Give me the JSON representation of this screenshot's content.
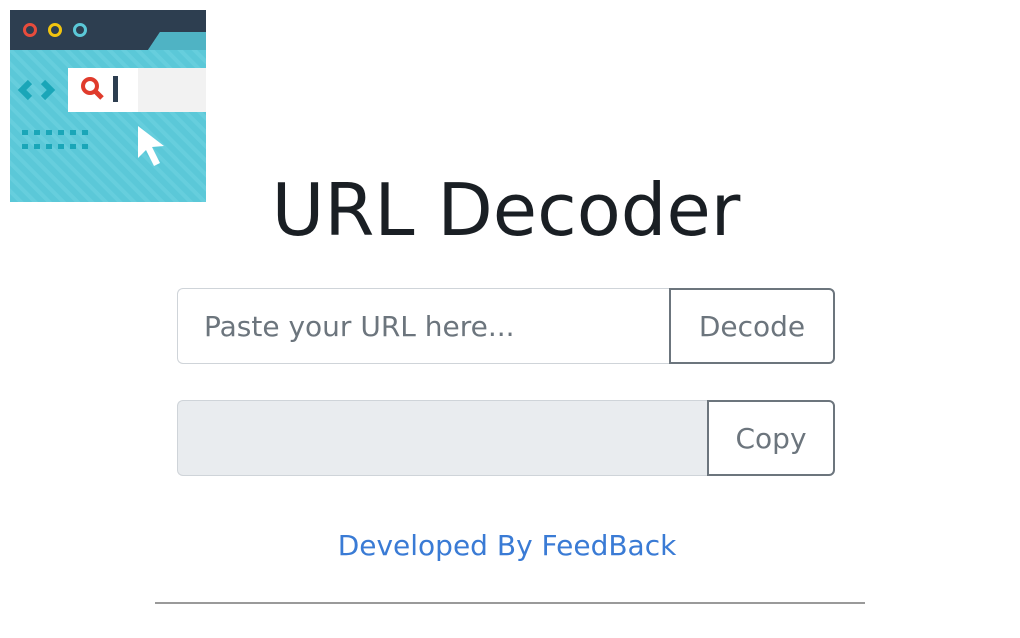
{
  "app": {
    "title": "URL Decoder"
  },
  "decode_row": {
    "input_placeholder": "Paste your URL here...",
    "input_value": "",
    "button_label": "Decode"
  },
  "copy_row": {
    "output_value": "",
    "button_label": "Copy"
  },
  "footer": {
    "link_text": "Developed By FeedBack"
  },
  "icon": {
    "name": "browser-search-icon",
    "colors": {
      "window_bg": "#5bc8d8",
      "titlebar": "#2d3e50",
      "dot_red": "#e74c3c",
      "dot_yellow": "#f1c40f",
      "dot_teal": "#5bc8d8",
      "search_bar": "#ffffff",
      "magnifier": "#e03b2c",
      "cursor": "#ffffff"
    }
  },
  "colors": {
    "title_text": "#1a1f24",
    "link": "#3a7bd5",
    "button_border": "#6c757d",
    "output_bg": "#e9ecef"
  }
}
